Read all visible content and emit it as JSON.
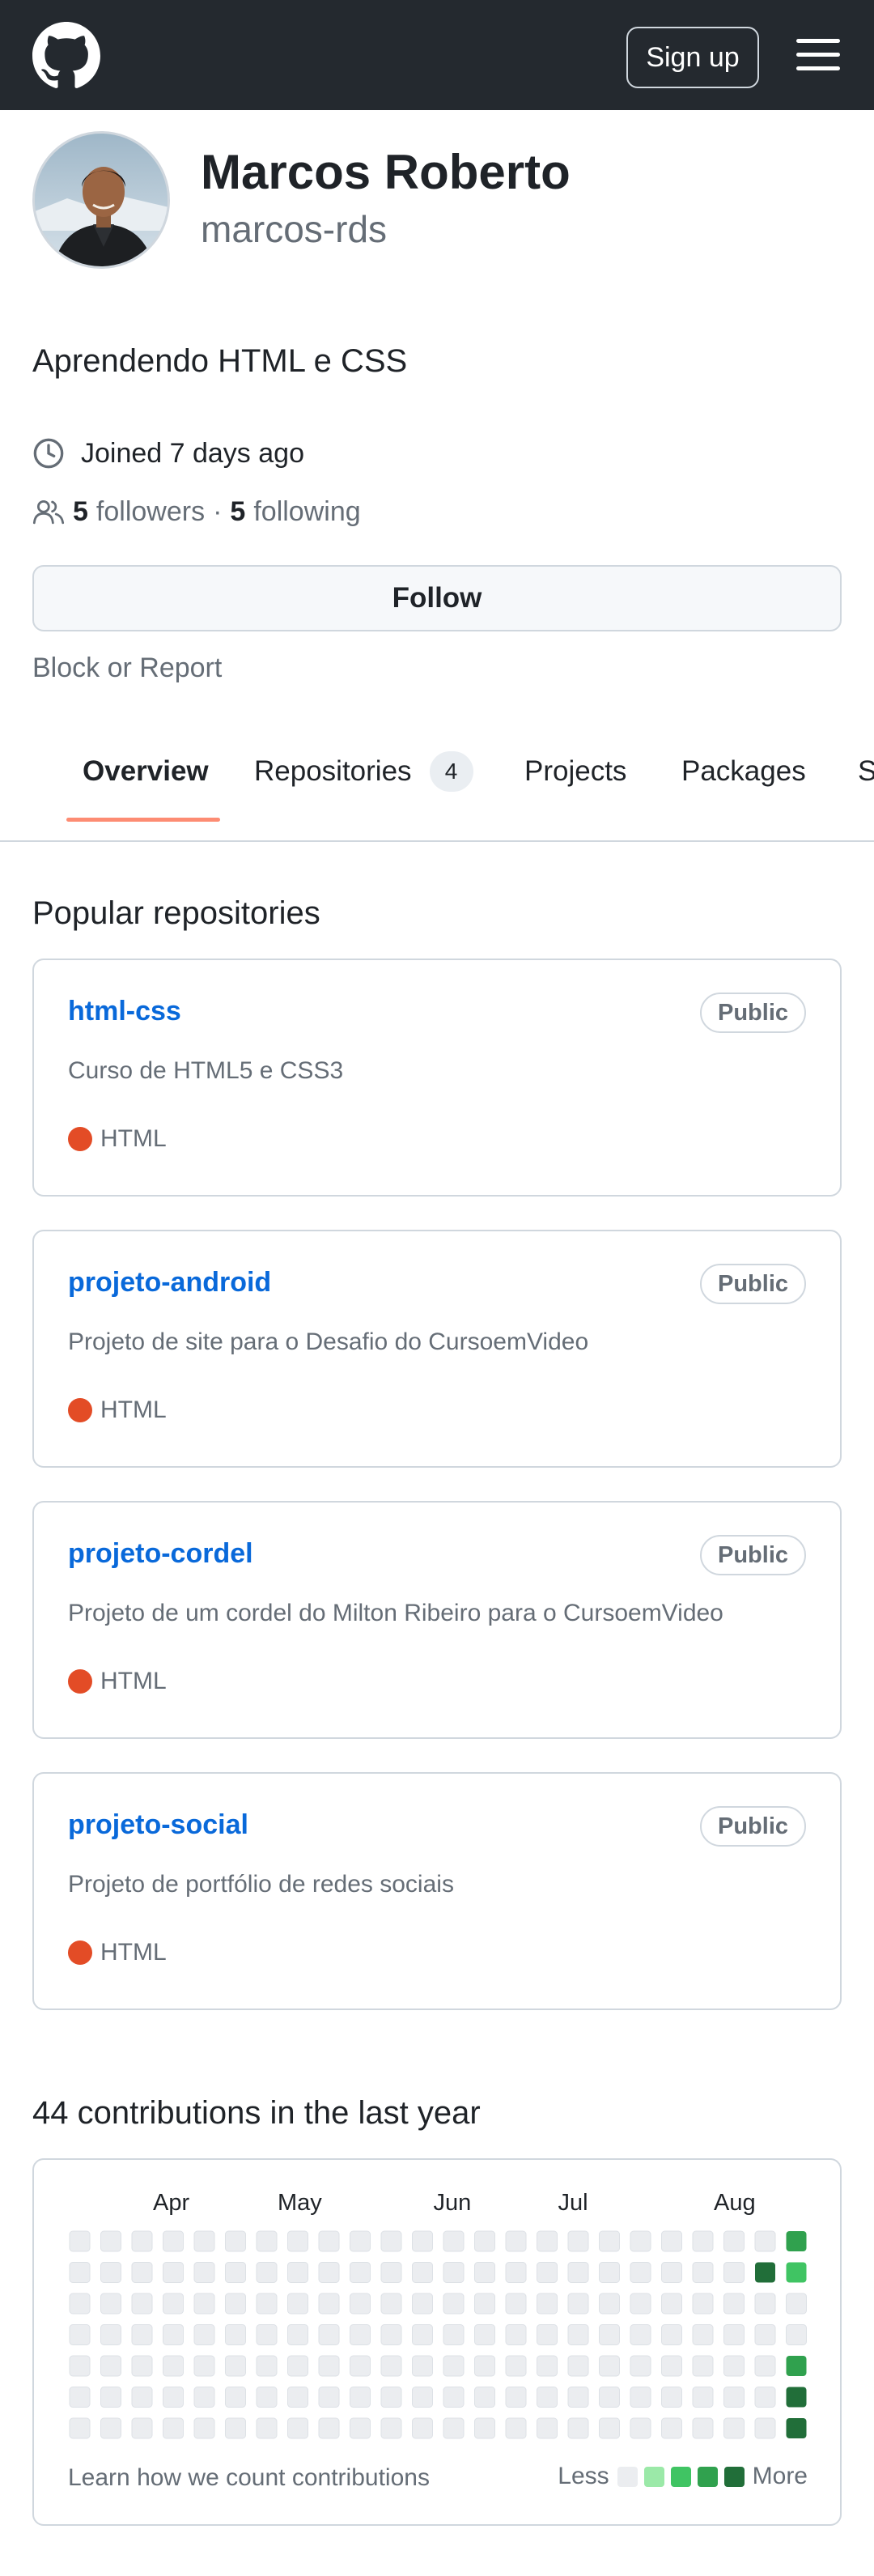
{
  "header": {
    "signup_label": "Sign up",
    "logo_icon": "github-icon",
    "menu_icon": "hamburger-menu-icon",
    "bg_color": "#24292f"
  },
  "profile": {
    "name": "Marcos Roberto",
    "login": "marcos-rds",
    "bio": "Aprendendo HTML e CSS",
    "joined": "Joined 7 days ago",
    "followers_count": "5",
    "followers_label": "followers",
    "separator": "·",
    "following_count": "5",
    "following_label": "following",
    "follow_button": "Follow",
    "block_report": "Block or Report"
  },
  "tabs": [
    {
      "label": "Overview",
      "active": true
    },
    {
      "label": "Repositories",
      "count": "4"
    },
    {
      "label": "Projects"
    },
    {
      "label": "Packages"
    },
    {
      "label": "S"
    }
  ],
  "popular": {
    "title": "Popular repositories",
    "repos": [
      {
        "name": "html-css",
        "visibility": "Public",
        "description": "Curso de HTML5 e CSS3",
        "language": "HTML",
        "language_color": "#e34c26"
      },
      {
        "name": "projeto-android",
        "visibility": "Public",
        "description": "Projeto de site para o Desafio do CursoemVideo",
        "language": "HTML",
        "language_color": "#e34c26"
      },
      {
        "name": "projeto-cordel",
        "visibility": "Public",
        "description": "Projeto de um cordel do Milton Ribeiro para o CursoemVideo",
        "language": "HTML",
        "language_color": "#e34c26"
      },
      {
        "name": "projeto-social",
        "visibility": "Public",
        "description": "Projeto de portfólio de redes sociais",
        "language": "HTML",
        "language_color": "#e34c26"
      }
    ]
  },
  "contributions": {
    "title": "44 contributions in the last year",
    "months": [
      "Apr",
      "May",
      "Jun",
      "Jul",
      "Aug"
    ],
    "levels_colors": [
      "#ebedf0",
      "#9be9a8",
      "#40c463",
      "#30a14e",
      "#216e39"
    ],
    "weeks": [
      [
        0,
        0,
        0,
        0,
        0,
        0,
        0
      ],
      [
        0,
        0,
        0,
        0,
        0,
        0,
        0
      ],
      [
        0,
        0,
        0,
        0,
        0,
        0,
        0
      ],
      [
        0,
        0,
        0,
        0,
        0,
        0,
        0
      ],
      [
        0,
        0,
        0,
        0,
        0,
        0,
        0
      ],
      [
        0,
        0,
        0,
        0,
        0,
        0,
        0
      ],
      [
        0,
        0,
        0,
        0,
        0,
        0,
        0
      ],
      [
        0,
        0,
        0,
        0,
        0,
        0,
        0
      ],
      [
        0,
        0,
        0,
        0,
        0,
        0,
        0
      ],
      [
        0,
        0,
        0,
        0,
        0,
        0,
        0
      ],
      [
        0,
        0,
        0,
        0,
        0,
        0,
        0
      ],
      [
        0,
        0,
        0,
        0,
        0,
        0,
        0
      ],
      [
        0,
        0,
        0,
        0,
        0,
        0,
        0
      ],
      [
        0,
        0,
        0,
        0,
        0,
        0,
        0
      ],
      [
        0,
        0,
        0,
        0,
        0,
        0,
        0
      ],
      [
        0,
        0,
        0,
        0,
        0,
        0,
        0
      ],
      [
        0,
        0,
        0,
        0,
        0,
        0,
        0
      ],
      [
        0,
        0,
        0,
        0,
        0,
        0,
        0
      ],
      [
        0,
        0,
        0,
        0,
        0,
        0,
        0
      ],
      [
        0,
        0,
        0,
        0,
        0,
        0,
        0
      ],
      [
        0,
        0,
        0,
        0,
        0,
        0,
        0
      ],
      [
        0,
        0,
        0,
        0,
        0,
        0,
        0
      ],
      [
        0,
        4,
        0,
        0,
        0,
        0,
        0
      ],
      [
        3,
        2,
        0,
        0,
        3,
        4,
        4
      ]
    ],
    "month_week_index": [
      2,
      6,
      11,
      15,
      20
    ],
    "learn_link": "Learn how we count contributions",
    "legend_less": "Less",
    "legend_more": "More"
  }
}
